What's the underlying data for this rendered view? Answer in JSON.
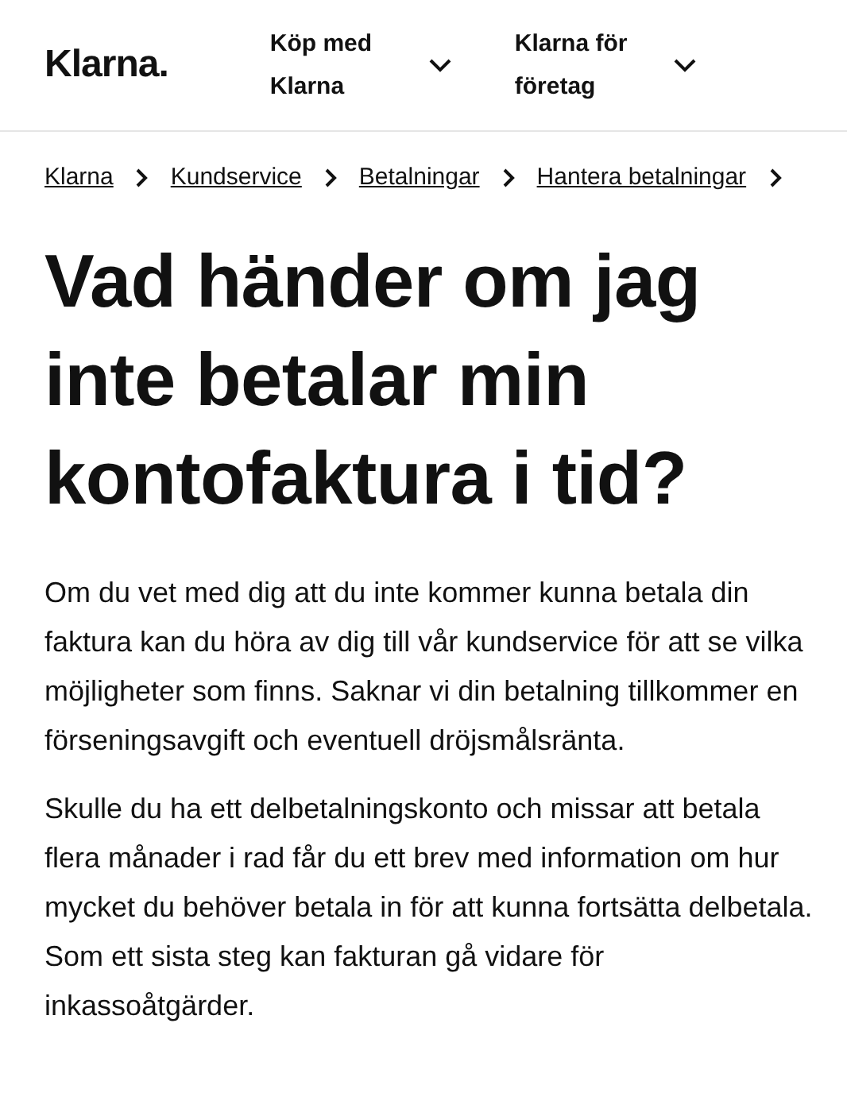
{
  "header": {
    "logo": "Klarna.",
    "nav": [
      {
        "label": "Köp med Klarna"
      },
      {
        "label": "Klarna för företag"
      }
    ]
  },
  "breadcrumb": [
    "Klarna",
    "Kundservice",
    "Betalningar",
    "Hantera betalningar"
  ],
  "title": "Vad händer om jag inte betalar min kontofaktura i tid?",
  "paragraphs": [
    "Om du vet med dig att du inte kommer kunna betala din faktura kan du höra av dig till vår kundservice för att se vilka möjligheter som finns. Saknar vi din betalning tillkommer en förseningsavgift och eventuell dröjsmålsränta.",
    "Skulle du ha ett delbetalningskonto och missar att betala flera månader i rad får du ett brev med information om hur mycket du behöver betala in för att kunna fortsätta delbetala. Som ett sista steg kan fakturan gå vidare för inkassoåtgärder."
  ]
}
